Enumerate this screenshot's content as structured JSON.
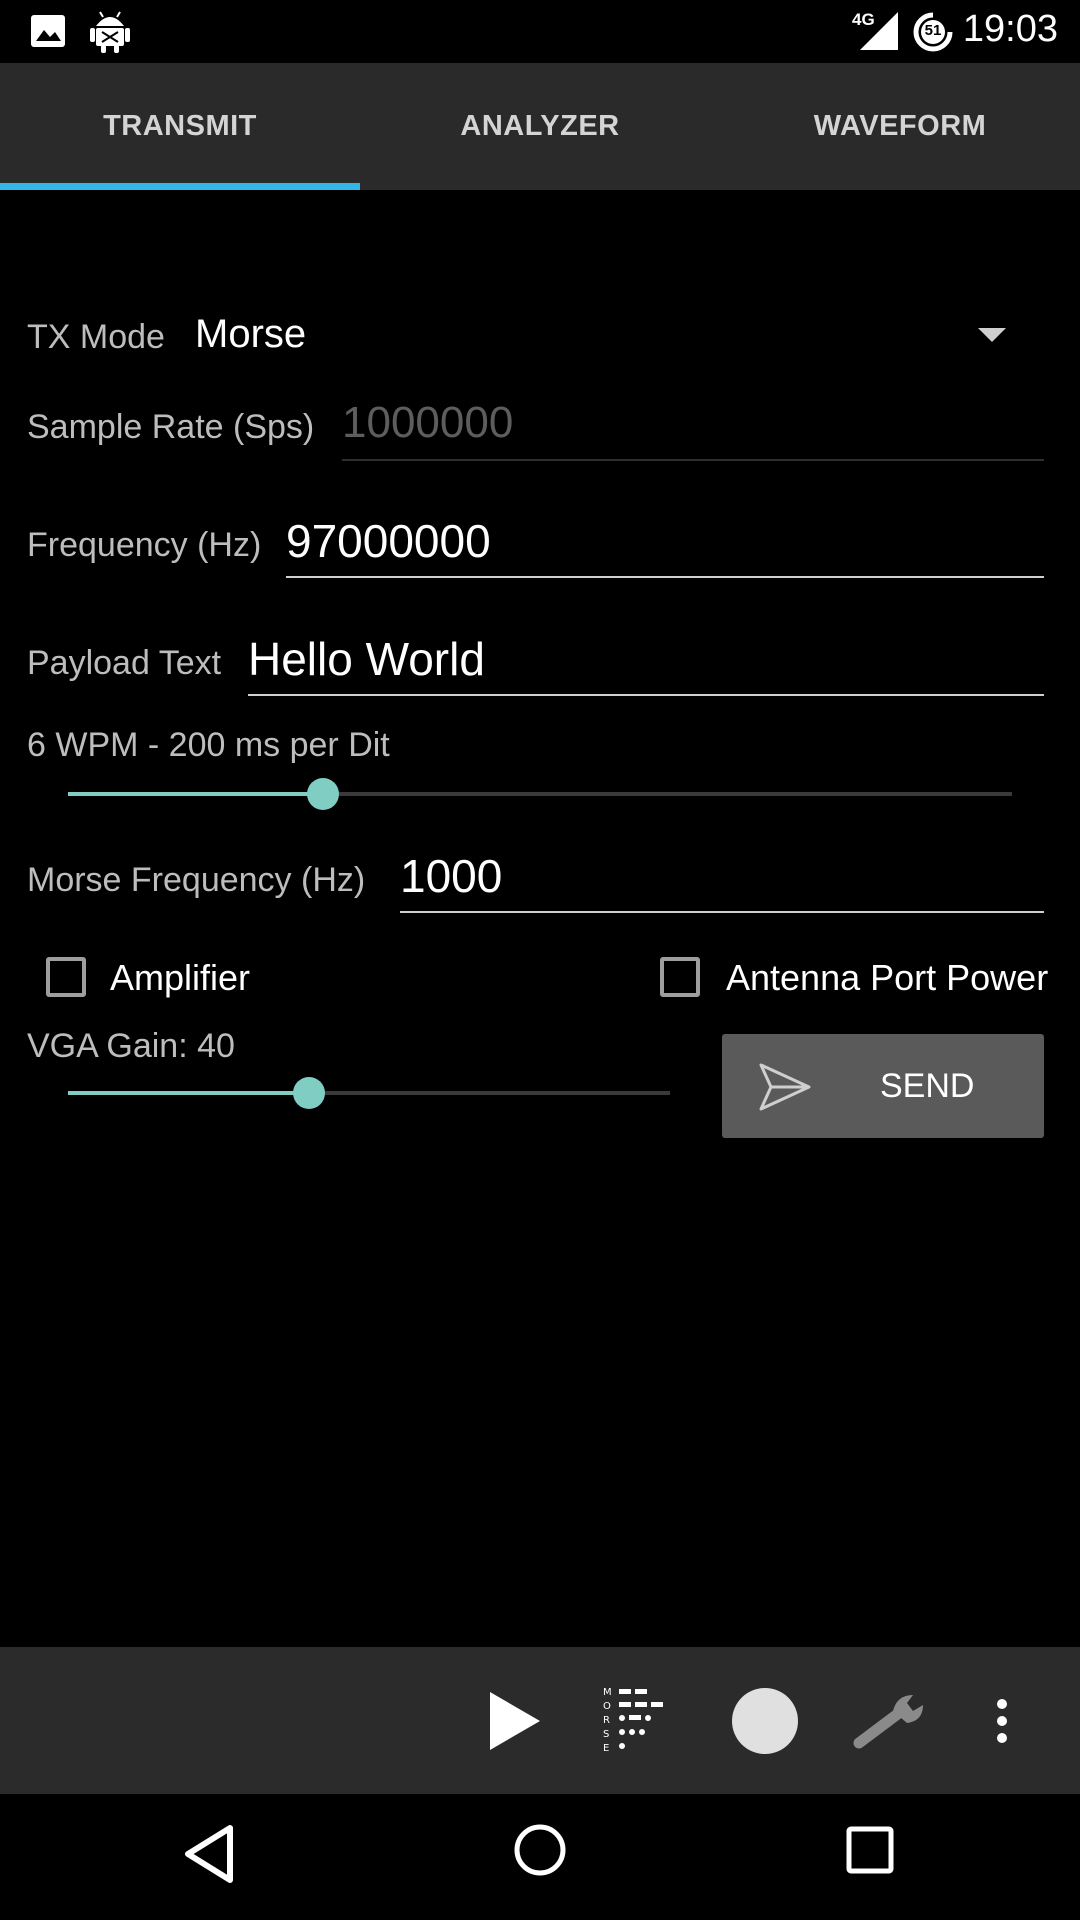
{
  "status_bar": {
    "time": "19:03",
    "network": "4G",
    "data_saver_count": "51",
    "icons": [
      "image-icon",
      "android-debug-icon",
      "signal-icon",
      "data-saver-icon"
    ]
  },
  "tabs": [
    {
      "label": "TRANSMIT",
      "active": true
    },
    {
      "label": "ANALYZER",
      "active": false
    },
    {
      "label": "WAVEFORM",
      "active": false
    }
  ],
  "form": {
    "tx_mode": {
      "label": "TX Mode",
      "value": "Morse"
    },
    "sample_rate": {
      "label": "Sample Rate (Sps)",
      "placeholder": "1000000"
    },
    "frequency": {
      "label": "Frequency (Hz)",
      "value": "97000000"
    },
    "payload": {
      "label": "Payload Text",
      "value": "Hello World"
    },
    "wpm": {
      "label": "6 WPM - 200 ms per Dit",
      "level": 0.27
    },
    "morse_frequency": {
      "label": "Morse Frequency (Hz)",
      "value": "1000"
    },
    "amplifier": {
      "label": "Amplifier",
      "checked": false
    },
    "antenna_power": {
      "label": "Antenna Port Power",
      "checked": false
    },
    "vga_gain": {
      "label": "VGA Gain: 40",
      "level": 0.4
    },
    "send": {
      "label": "SEND"
    }
  },
  "toolbar": {
    "icons": [
      "play-icon",
      "morse-icon",
      "record-icon",
      "wrench-icon",
      "overflow-menu-icon"
    ]
  },
  "nav": {
    "icons": [
      "back-icon",
      "home-icon",
      "recents-icon"
    ]
  },
  "colors": {
    "accent": "#33b5e5",
    "slider": "#7fcdc3",
    "tab_bar": "#2a2a2a",
    "toolbar": "#2b2b2b"
  }
}
